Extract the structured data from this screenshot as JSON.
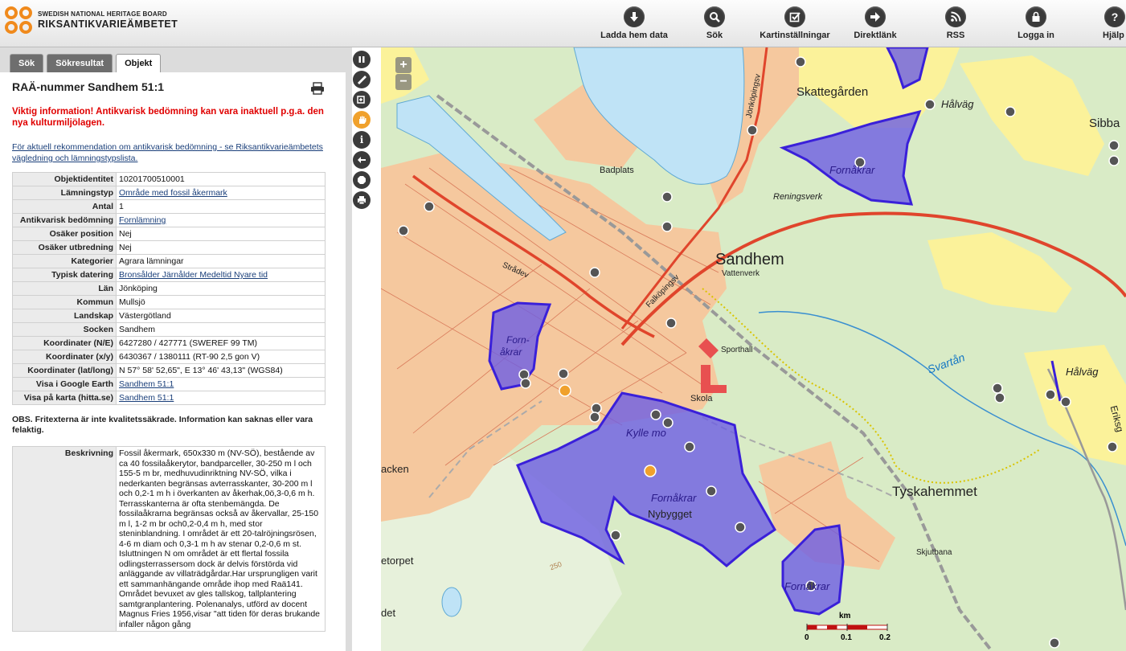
{
  "header": {
    "logo_line1": "SWEDISH NATIONAL HERITAGE BOARD",
    "logo_line2": "RIKSANTIKVARIEÄMBETET",
    "tools": [
      {
        "label": "Ladda hem data",
        "icon": "download-icon"
      },
      {
        "label": "Sök",
        "icon": "search-icon"
      },
      {
        "label": "Kartinställningar",
        "icon": "map-settings-icon"
      },
      {
        "label": "Direktlänk",
        "icon": "direct-link-icon"
      },
      {
        "label": "RSS",
        "icon": "rss-icon"
      },
      {
        "label": "Logga in",
        "icon": "lock-icon"
      },
      {
        "label": "Hjälp",
        "icon": "help-icon"
      }
    ]
  },
  "tabs": [
    {
      "label": "Sök",
      "active": false
    },
    {
      "label": "Sökresultat",
      "active": false
    },
    {
      "label": "Objekt",
      "active": true
    }
  ],
  "object": {
    "title": "RAÄ-nummer Sandhem 51:1",
    "warning": "Viktig information! Antikvarisk bedömning kan vara inaktuell p.g.a. den nya kulturmiljölagen.",
    "info_link": "För aktuell rekommendation om antikvarisk bedömning - se Riksantikvarieämbetets vägledning och lämningstypslista.",
    "attributes": [
      {
        "key": "Objektidentitet",
        "value": "10201700510001",
        "link": false
      },
      {
        "key": "Lämningstyp",
        "value": "Område med fossil åkermark",
        "link": true
      },
      {
        "key": "Antal",
        "value": "1",
        "link": false
      },
      {
        "key": "Antikvarisk bedömning",
        "value": "Fornlämning",
        "link": true
      },
      {
        "key": "Osäker position",
        "value": "Nej",
        "link": false
      },
      {
        "key": "Osäker utbredning",
        "value": "Nej",
        "link": false
      },
      {
        "key": "Kategorier",
        "value": "Agrara lämningar",
        "link": false
      },
      {
        "key": "Typisk datering",
        "value": "Bronsålder Järnålder Medeltid Nyare tid",
        "link": true
      },
      {
        "key": "Län",
        "value": "Jönköping",
        "link": false
      },
      {
        "key": "Kommun",
        "value": "Mullsjö",
        "link": false
      },
      {
        "key": "Landskap",
        "value": "Västergötland",
        "link": false
      },
      {
        "key": "Socken",
        "value": "Sandhem",
        "link": false
      },
      {
        "key": "Koordinater (N/E)",
        "value": "6427280 / 427771 (SWEREF 99 TM)",
        "link": false
      },
      {
        "key": "Koordinater (x/y)",
        "value": "6430367 / 1380111 (RT-90 2,5 gon V)",
        "link": false
      },
      {
        "key": "Koordinater (lat/long)",
        "value": "N 57° 58' 52,65\", E 13° 46' 43,13\" (WGS84)",
        "link": false
      },
      {
        "key": "Visa i Google Earth",
        "value": "Sandhem 51:1",
        "link": true
      },
      {
        "key": "Visa på karta (hitta.se)",
        "value": "Sandhem 51:1",
        "link": true
      }
    ],
    "obs": "OBS. Fritexterna är inte kvalitetssäkrade. Information kan saknas eller vara felaktig.",
    "description_key": "Beskrivning",
    "description": "Fossil åkermark, 650x330 m (NV-SÖ), bestående av ca 40 fossilaåkerytor, bandparceller, 30-250 m l och 155-5 m br, medhuvudinriktning NV-SÖ, vilka i nederkanten begränsas avterrasskanter, 30-200 m l och 0,2-1 m h i överkanten av åkerhak,0ö,3-0,6 m h. Terrasskanterna är ofta stenbemängda. De fossilaåkrarna begränsas också av åkervallar, 25-150 m l, 1-2 m br och0,2-0,4 m h, med stor steninblandning. I området är ett 20-talröjningsrösen, 4-6 m diam och 0,3-1 m h av stenar 0,2-0,6 m st. Isluttningen N om området är ett flertal fossila odlingsterrassersom dock är delvis förstörda vid anläggande av villaträdgårdar.Har ursprungligen varit ett sammanhängande område ihop med Raä141. Området bevuxet av gles tallskog, tallplantering samtgranplantering. Polenanalys, utförd av docent Magnus Fries 1956,visar \"att tiden för deras brukande infaller någon gång"
  },
  "map": {
    "labels": [
      {
        "text": "Skattegården",
        "name": "map-label-skattegarden"
      },
      {
        "text": "Hålväg",
        "name": "map-label-halvag-1"
      },
      {
        "text": "Sibba",
        "name": "map-label-sibba"
      },
      {
        "text": "Fornåkrar",
        "name": "map-label-fornakrar-1"
      },
      {
        "text": "Badplats",
        "name": "map-label-badplats"
      },
      {
        "text": "Reningsverk",
        "name": "map-label-reningsverk"
      },
      {
        "text": "Sandhem",
        "name": "map-label-sandhem"
      },
      {
        "text": "Vattenverk",
        "name": "map-label-vattenverk"
      },
      {
        "text": "Strådev",
        "name": "map-label-stradev"
      },
      {
        "text": "Falköpingsv",
        "name": "map-label-falkopingsv"
      },
      {
        "text": "Jönköpingsv",
        "name": "map-label-jonkopingsv"
      },
      {
        "text": "Forn-",
        "name": "map-label-forn"
      },
      {
        "text": "åkrar",
        "name": "map-label-akrar"
      },
      {
        "text": "Sporthall",
        "name": "map-label-sporthall"
      },
      {
        "text": "Svartån",
        "name": "map-label-svartan"
      },
      {
        "text": "Hålväg",
        "name": "map-label-halvag-2"
      },
      {
        "text": "Eriksg",
        "name": "map-label-eriksg"
      },
      {
        "text": "Skola",
        "name": "map-label-skola"
      },
      {
        "text": "Kylle mo",
        "name": "map-label-kylle-mo"
      },
      {
        "text": "Fornåkrar",
        "name": "map-label-fornakrar-2"
      },
      {
        "text": "Nybygget",
        "name": "map-label-nybygget"
      },
      {
        "text": "Tyskahemmet",
        "name": "map-label-tyskahemmet"
      },
      {
        "text": "acken",
        "name": "map-label-acken"
      },
      {
        "text": "etorpet",
        "name": "map-label-etorpet"
      },
      {
        "text": "Skjutbana",
        "name": "map-label-skjutbana"
      },
      {
        "text": "Fornåkrar",
        "name": "map-label-fornakrar-3"
      },
      {
        "text": "det",
        "name": "map-label-det"
      },
      {
        "text": "250",
        "name": "map-label-contour-250"
      }
    ],
    "scale": {
      "unit": "km",
      "ticks": [
        "0",
        "0.1",
        "0.2"
      ]
    },
    "colors": {
      "forest": "#d9ebc6",
      "field": "#fbf29a",
      "urban": "#f5c89e",
      "water": "#bfe3f6",
      "polygon": "#6d5ee4",
      "road": "#e0452c"
    }
  }
}
